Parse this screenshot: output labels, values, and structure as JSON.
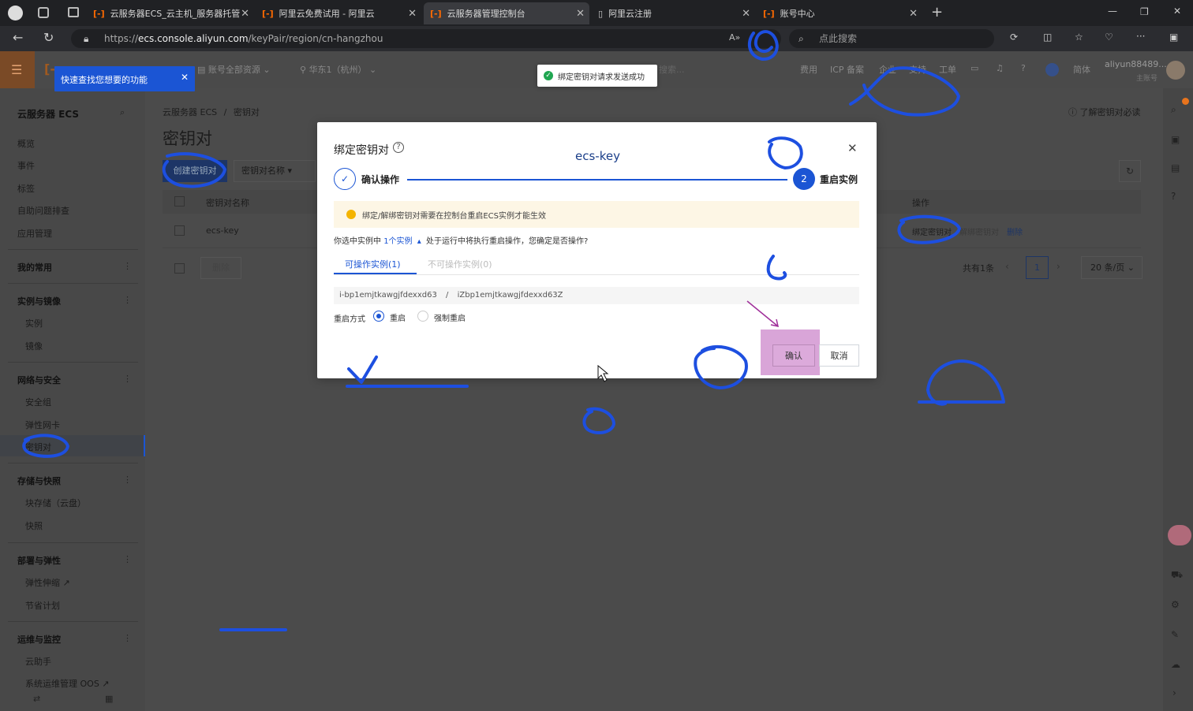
{
  "browser": {
    "tabs": [
      {
        "label": "云服务器ECS_云主机_服务器托管"
      },
      {
        "label": "阿里云免费试用 - 阿里云"
      },
      {
        "label": "云服务器管理控制台"
      },
      {
        "label": "阿里云注册"
      },
      {
        "label": "账号中心"
      }
    ],
    "url_prefix": "https://",
    "url_host": "ecs.console.aliyun.com",
    "url_path": "/keyPair/region/cn-hangzhou",
    "search_placeholder": "点此搜索"
  },
  "topnav": {
    "account_scope": "账号全部资源",
    "region": "华东1（杭州）",
    "search_hint": "搜索...",
    "items": [
      "费用",
      "ICP 备案",
      "企业",
      "支持",
      "工单"
    ],
    "lang": "简体",
    "username": "aliyun88489...",
    "user_role": "主账号"
  },
  "tooltip": {
    "text": "快速查找您想要的功能"
  },
  "toast": {
    "text": "绑定密钥对请求发送成功"
  },
  "sidebar": {
    "title": "云服务器 ECS",
    "items": [
      "概览",
      "事件",
      "标签",
      "自助问题排查",
      "应用管理"
    ],
    "groups": [
      {
        "title": "我的常用",
        "items": []
      },
      {
        "title": "实例与镜像",
        "items": [
          "实例",
          "镜像"
        ]
      },
      {
        "title": "网络与安全",
        "items": [
          "安全组",
          "弹性网卡",
          "密钥对"
        ]
      },
      {
        "title": "存储与快照",
        "items": [
          "块存储（云盘）",
          "快照"
        ]
      },
      {
        "title": "部署与弹性",
        "items": [
          "弹性伸缩",
          "节省计划"
        ]
      },
      {
        "title": "运维与监控",
        "items": [
          "云助手",
          "系统运维管理 OOS"
        ]
      }
    ]
  },
  "page": {
    "breadcrumb": [
      "云服务器 ECS",
      "密钥对"
    ],
    "title": "密钥对",
    "help_link": "了解密钥对必读",
    "create_button": "创建密钥对",
    "filter_select": "密钥对名称",
    "table": {
      "columns": [
        "密钥对名称",
        "操作"
      ],
      "rows": [
        {
          "name": "ecs-key",
          "actions": [
            "绑定密钥对",
            "解绑密钥对",
            "删除"
          ]
        }
      ]
    },
    "delete_button": "删除",
    "pagination": {
      "total": "共有1条",
      "page": "1",
      "page_size": "20 条/页"
    }
  },
  "modal": {
    "title": "绑定密钥对",
    "key_name": "ecs-key",
    "steps": [
      {
        "num": "",
        "label": "确认操作"
      },
      {
        "num": "2",
        "label": "重启实例"
      }
    ],
    "notice": "绑定/解绑密钥对需要在控制台重启ECS实例才能生效",
    "selected_prefix": "你选中实例中",
    "selected_link": "1个实例",
    "selected_suffix": "处于运行中将执行重启操作，您确定是否操作?",
    "tabs": [
      "可操作实例(1)",
      "不可操作实例(0)"
    ],
    "instance_id": "i-bp1emjtkawgjfdexxd63",
    "instance_sep": "/",
    "instance_name": "iZbp1emjtkawgjfdexxd63Z",
    "restart_label": "重启方式",
    "restart_options": [
      "重启",
      "强制重启"
    ],
    "confirm_button": "确认",
    "cancel_button": "取消"
  },
  "colors": {
    "accent": "#1b55d4",
    "annotation": "#1d4fe0",
    "highlight": "#d9a5d8",
    "arrow": "#a0309a"
  }
}
